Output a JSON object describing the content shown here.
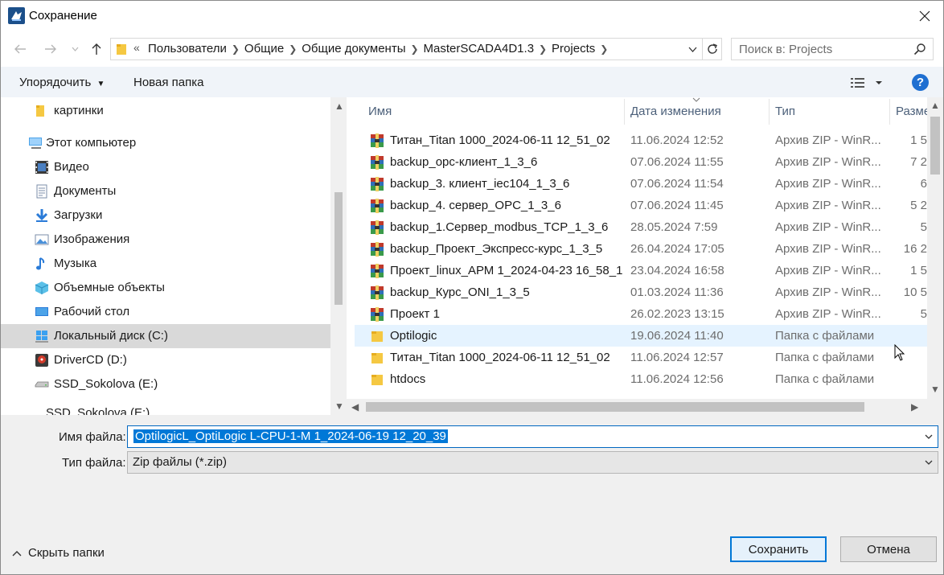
{
  "window": {
    "title": "Сохранение"
  },
  "address": {
    "overflow_marker": "«",
    "crumbs": [
      "Пользователи",
      "Общие",
      "Общие документы",
      "MasterSCADA4D1.3",
      "Projects"
    ]
  },
  "search": {
    "placeholder": "Поиск в: Projects"
  },
  "toolbar": {
    "organize_label": "Упорядочить",
    "new_folder_label": "Новая папка",
    "help_label": "?"
  },
  "nav": {
    "items": [
      {
        "label": "картинки",
        "icon": "folder-icon"
      },
      {
        "label": "Этот компьютер",
        "icon": "computer-icon"
      },
      {
        "label": "Видео",
        "icon": "video-icon"
      },
      {
        "label": "Документы",
        "icon": "documents-icon"
      },
      {
        "label": "Загрузки",
        "icon": "downloads-icon"
      },
      {
        "label": "Изображения",
        "icon": "pictures-icon"
      },
      {
        "label": "Музыка",
        "icon": "music-icon"
      },
      {
        "label": "Объемные объекты",
        "icon": "3d-objects-icon"
      },
      {
        "label": "Рабочий стол",
        "icon": "desktop-icon"
      },
      {
        "label": "Локальный диск (C:)",
        "icon": "windows-drive-icon",
        "selected": true
      },
      {
        "label": "DriverCD (D:)",
        "icon": "cd-drive-icon"
      },
      {
        "label": "SSD_Sokolova (E:)",
        "icon": "drive-icon"
      },
      {
        "label": "SSD_Sokolova (E:)",
        "icon": "drive-icon"
      }
    ]
  },
  "columns": {
    "name": "Имя",
    "date": "Дата изменения",
    "type": "Тип",
    "size": "Разме"
  },
  "files": [
    {
      "name": "Титан_Titan 1000_2024-06-11 12_51_02",
      "date": "11.06.2024 12:52",
      "type": "Архив ZIP - WinR...",
      "size": "1 5",
      "icon": "winrar-archive-icon"
    },
    {
      "name": "backup_орс-клиент_1_3_6",
      "date": "07.06.2024 11:55",
      "type": "Архив ZIP - WinR...",
      "size": "7 2",
      "icon": "winrar-archive-icon"
    },
    {
      "name": "backup_3. клиент_iec104_1_3_6",
      "date": "07.06.2024 11:54",
      "type": "Архив ZIP - WinR...",
      "size": "6",
      "icon": "winrar-archive-icon"
    },
    {
      "name": "backup_4. сервер_OPC_1_3_6",
      "date": "07.06.2024 11:45",
      "type": "Архив ZIP - WinR...",
      "size": "5 2",
      "icon": "winrar-archive-icon"
    },
    {
      "name": "backup_1.Сервер_modbus_TCP_1_3_6",
      "date": "28.05.2024 7:59",
      "type": "Архив ZIP - WinR...",
      "size": "5",
      "icon": "winrar-archive-icon"
    },
    {
      "name": "backup_Проект_Экспресс-курс_1_3_5",
      "date": "26.04.2024 17:05",
      "type": "Архив ZIP - WinR...",
      "size": "16 2",
      "icon": "winrar-archive-icon"
    },
    {
      "name": "Проект_linux_АРМ 1_2024-04-23 16_58_17",
      "date": "23.04.2024 16:58",
      "type": "Архив ZIP - WinR...",
      "size": "1 5",
      "icon": "winrar-archive-icon"
    },
    {
      "name": "backup_Курс_ONI_1_3_5",
      "date": "01.03.2024 11:36",
      "type": "Архив ZIP - WinR...",
      "size": "10 5",
      "icon": "winrar-archive-icon"
    },
    {
      "name": "Проект 1",
      "date": "26.02.2023 13:15",
      "type": "Архив ZIP - WinR...",
      "size": "5",
      "icon": "winrar-archive-icon"
    },
    {
      "name": "Optilogic",
      "date": "19.06.2024 11:40",
      "type": "Папка с файлами",
      "size": "",
      "icon": "folder-icon",
      "selected": true
    },
    {
      "name": "Титан_Titan 1000_2024-06-11 12_51_02",
      "date": "11.06.2024 12:57",
      "type": "Папка с файлами",
      "size": "",
      "icon": "folder-icon"
    },
    {
      "name": "htdocs",
      "date": "11.06.2024 12:56",
      "type": "Папка с файлами",
      "size": "",
      "icon": "folder-icon"
    }
  ],
  "form": {
    "filename_label": "Имя файла:",
    "filename_value": "OptilogicL_OptiLogic L-CPU-1-M 1_2024-06-19 12_20_39",
    "filetype_label": "Тип файла:",
    "filetype_value": "Zip файлы (*.zip)"
  },
  "footer": {
    "hide_folders_label": "Скрыть папки",
    "save_label": "Сохранить",
    "cancel_label": "Отмена"
  },
  "colors": {
    "accent": "#0078d7",
    "selection": "#e5f3ff",
    "nav_selected": "#d9d9d9",
    "toolbar_bg": "#f0f4f9"
  }
}
